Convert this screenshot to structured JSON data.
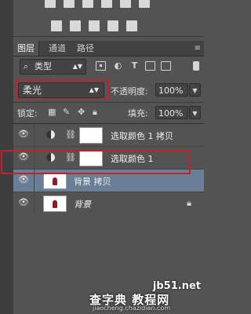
{
  "tabs": [
    {
      "label": "图层",
      "active": true
    },
    {
      "label": "通道",
      "active": false
    },
    {
      "label": "路径",
      "active": false
    }
  ],
  "filter": {
    "label": "类型",
    "icons": [
      "image-filter-icon",
      "adjustment-filter-icon",
      "text-filter-icon",
      "shape-filter-icon",
      "smart-object-filter-icon"
    ]
  },
  "blend": {
    "mode": "柔光",
    "opacity_label": "不透明度:",
    "opacity": "100%"
  },
  "lock": {
    "label": "锁定:",
    "fill_label": "填充:",
    "fill": "100%"
  },
  "layers": [
    {
      "name": "选取颜色 1 拷贝",
      "type": "adjustment",
      "selected": false
    },
    {
      "name": "选取颜色 1",
      "type": "adjustment",
      "selected": false
    },
    {
      "name": "背景 拷贝",
      "type": "image",
      "selected": true
    },
    {
      "name": "背景",
      "type": "image",
      "selected": false,
      "locked": true
    }
  ],
  "watermark": {
    "line1": "jb51.net",
    "line2": "查字典 教程网",
    "line3": "jiaocheng.chazidian.com"
  },
  "colors": {
    "selected_layer": "#6a7e96",
    "highlight": "#c0222a",
    "panel": "#535353"
  }
}
